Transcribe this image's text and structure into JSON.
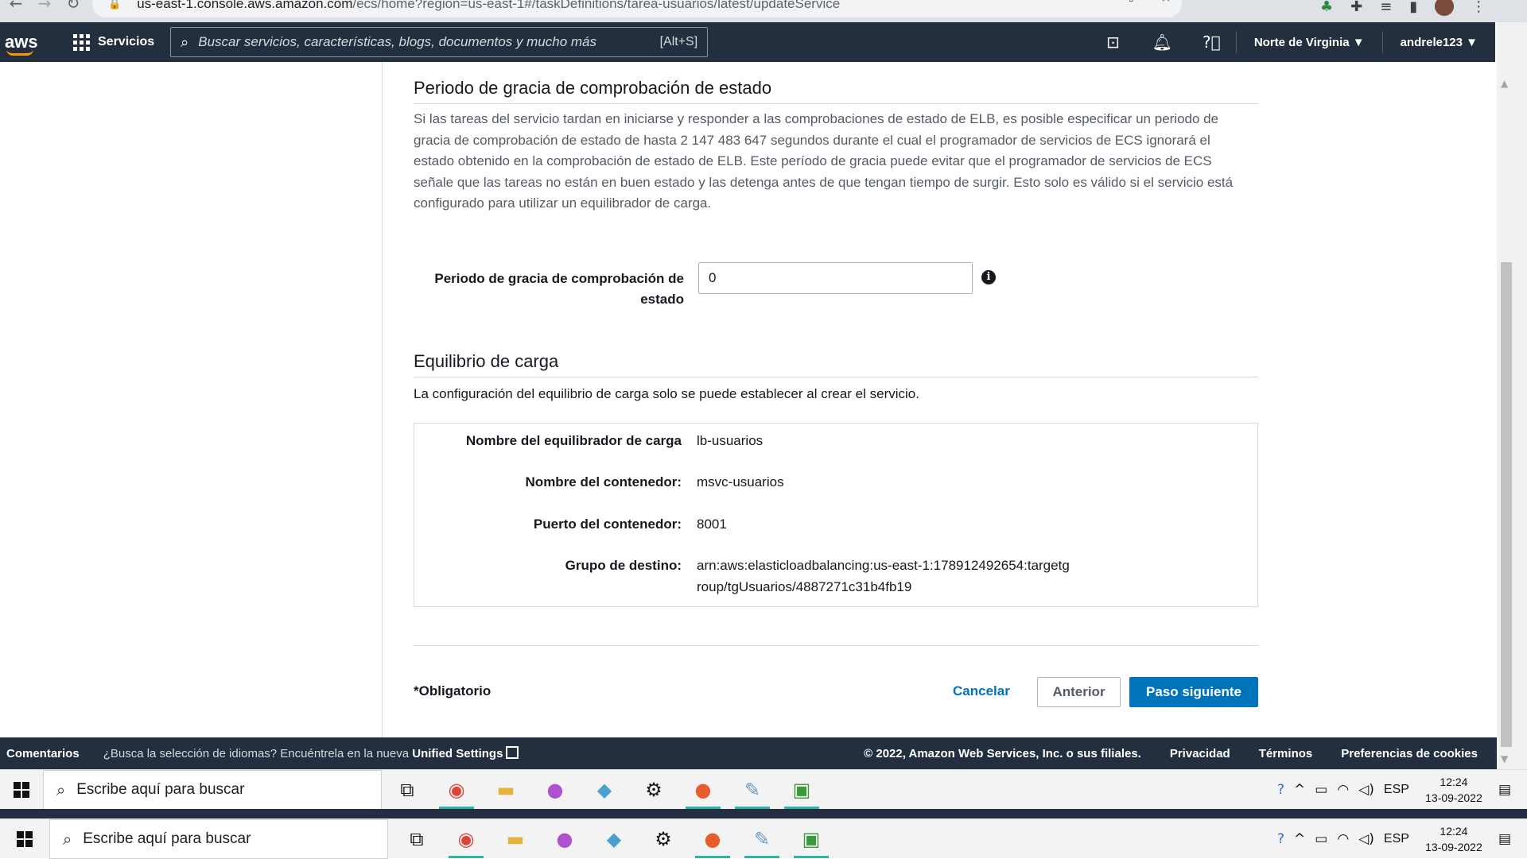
{
  "browser": {
    "url_host": "us-east-1.console.aws.amazon.com",
    "url_path": "/ecs/home?region=us-east-1#/taskDefinitions/tarea-usuarios/latest/updateService"
  },
  "nav": {
    "logo": "aws",
    "services_label": "Servicios",
    "search_placeholder": "Buscar servicios, características, blogs, documentos y mucho más",
    "search_shortcut": "[Alt+S]",
    "region": "Norte de Virginia ▼",
    "user": "andrele123 ▼"
  },
  "grace": {
    "title": "Periodo de gracia de comprobación de estado",
    "description": "Si las tareas del servicio tardan en iniciarse y responder a las comprobaciones de estado de ELB, es posible especificar un periodo de gracia de comprobación de estado de hasta 2 147 483 647 segundos durante el cual el programador de servicios de ECS ignorará el estado obtenido en la comprobación de estado de ELB. Este período de gracia puede evitar que el programador de servicios de ECS señale que las tareas no están en buen estado y las detenga antes de que tengan tiempo de surgir. Esto solo es válido si el servicio está configurado para utilizar un equilibrador de carga.",
    "field_label": "Periodo de gracia de comprobación de estado",
    "field_value": "0"
  },
  "load_balancing": {
    "title": "Equilibrio de carga",
    "description": "La configuración del equilibrio de carga solo se puede establecer al crear el servicio.",
    "rows": [
      {
        "key": "Nombre del equilibrador de carga",
        "value": "lb-usuarios"
      },
      {
        "key": "Nombre del contenedor:",
        "value": "msvc-usuarios"
      },
      {
        "key": "Puerto del contenedor:",
        "value": "8001"
      },
      {
        "key": "Grupo de destino:",
        "value": "arn:aws:elasticloadbalancing:us-east-1:178912492654:targetgroup/tgUsuarios/4887271c31b4fb19"
      }
    ]
  },
  "actions": {
    "required_note": "*Obligatorio",
    "cancel": "Cancelar",
    "previous": "Anterior",
    "next": "Paso siguiente"
  },
  "footer": {
    "feedback": "Comentarios",
    "lang_prompt": "¿Busca la selección de idiomas? Encuéntrela en la nueva ",
    "unified_settings": "Unified Settings",
    "copyright": "© 2022, Amazon Web Services, Inc. o sus filiales.",
    "privacy": "Privacidad",
    "terms": "Términos",
    "cookies": "Preferencias de cookies"
  },
  "taskbar": {
    "search_placeholder": "Escribe aquí para buscar",
    "lang": "ESP",
    "time": "12:24",
    "date": "13-09-2022"
  },
  "colors": {
    "aws_nav": "#232f3e",
    "aws_orange": "#ff9900",
    "primary_button": "#0073bb",
    "link": "#0073bb"
  }
}
